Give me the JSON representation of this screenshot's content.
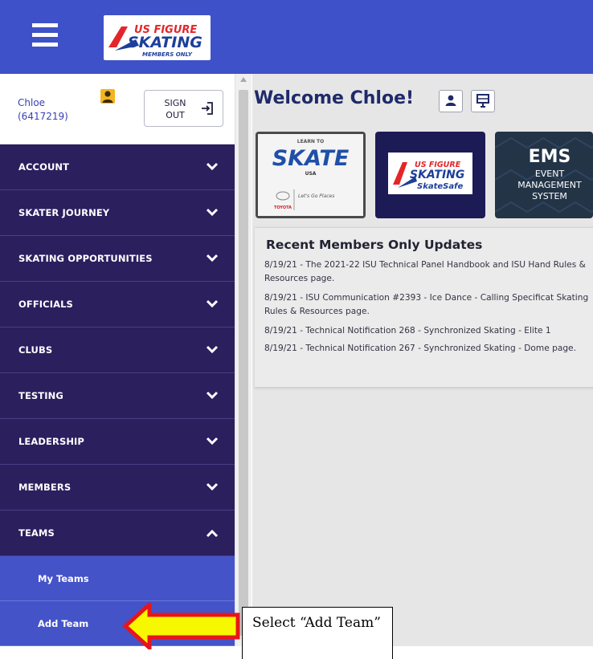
{
  "header": {
    "menu_icon": "hamburger-icon",
    "logo": {
      "line1": "US FIGURE",
      "line2": "SKATING",
      "tagline": "MEMBERS ONLY"
    },
    "background_color": "#3f51c8"
  },
  "user": {
    "name": "Chloe",
    "member_id": "(6417219)",
    "avatar_icon": "user-icon",
    "signout_line1": "SIGN",
    "signout_line2": "OUT",
    "signout_icon": "sign-out-icon"
  },
  "sidebar": {
    "background_color": "#2b1f5e",
    "items": [
      {
        "label": "ACCOUNT",
        "state": "collapsed"
      },
      {
        "label": "SKATER JOURNEY",
        "state": "collapsed"
      },
      {
        "label": "SKATING OPPORTUNITIES",
        "state": "collapsed"
      },
      {
        "label": "OFFICIALS",
        "state": "collapsed"
      },
      {
        "label": "CLUBS",
        "state": "collapsed"
      },
      {
        "label": "TESTING",
        "state": "collapsed"
      },
      {
        "label": "LEADERSHIP",
        "state": "collapsed"
      },
      {
        "label": "MEMBERS",
        "state": "collapsed"
      },
      {
        "label": "TEAMS",
        "state": "expanded"
      }
    ],
    "teams_subitems": [
      {
        "label": "My Teams"
      },
      {
        "label": "Add Team"
      }
    ]
  },
  "main": {
    "welcome": "Welcome Chloe!",
    "welcome_buttons": [
      "user-icon",
      "monitor-icon"
    ],
    "tiles": [
      {
        "name": "learn-to-skate",
        "top_text": "LEARN TO",
        "main_text": "SKATE",
        "sub_text": "USA",
        "sponsor": "TOYOTA",
        "sponsor_tagline": "Let's Go Places"
      },
      {
        "name": "skatesafe",
        "line1": "US FIGURE",
        "line2": "SKATING",
        "line3": "SkateSafe"
      },
      {
        "name": "ems",
        "title": "EMS",
        "line1": "EVENT",
        "line2": "MANAGEMENT",
        "line3": "SYSTEM"
      }
    ],
    "updates": {
      "title": "Recent Members Only Updates",
      "items": [
        "8/19/21 - The 2021-22 ISU Technical Panel Handbook and ISU Hand Rules & Resources page.",
        "8/19/21 - ISU Communication #2393 - Ice Dance - Calling Specificat Skating Rules & Resources page.",
        "8/19/21 - Technical Notification 268 - Synchronized Skating - Elite 1",
        "8/19/21 - Technical Notification 267 - Synchronized Skating - Dome page."
      ]
    }
  },
  "annotation": {
    "text": "Select “Add Team”",
    "arrow_color": "#f7f700",
    "arrow_outline": "#e8141a"
  }
}
